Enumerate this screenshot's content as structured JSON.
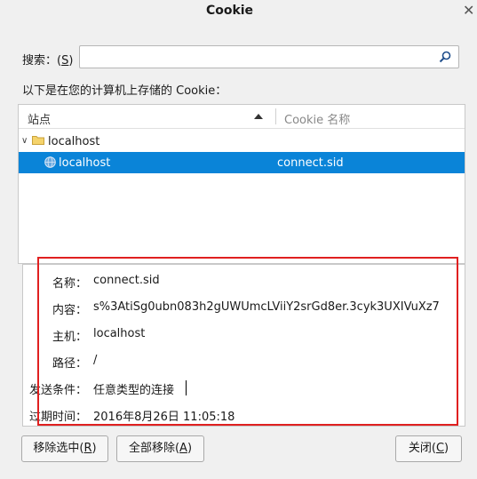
{
  "window": {
    "title": "Cookie",
    "close_glyph": "✕"
  },
  "search": {
    "label": "搜索：(",
    "key": "S",
    "label_end": ")",
    "value": "",
    "icon": "search-icon"
  },
  "caption": "以下是在您的计算机上存储的 Cookie：",
  "tree": {
    "columns": {
      "site": "站点",
      "cookie": "Cookie 名称"
    },
    "rows": [
      {
        "label": "localhost",
        "icon": "folder-icon",
        "expanded": true
      },
      {
        "label": "localhost",
        "value": "connect.sid",
        "icon": "globe-icon",
        "selected": true
      }
    ]
  },
  "details": {
    "fields": [
      {
        "label": "名称：",
        "value": "connect.sid"
      },
      {
        "label": "内容：",
        "value": "s%3AtiSg0ubn083h2gUWUmcLViiY2srGd8er.3cyk3UXIVuXz7"
      },
      {
        "label": "主机：",
        "value": "localhost"
      },
      {
        "label": "路径：",
        "value": "/"
      },
      {
        "label": "发送条件：",
        "value": "任意类型的连接"
      },
      {
        "label": "过期时间：",
        "value": "2016年8月26日 11:05:18"
      }
    ]
  },
  "buttons": {
    "remove_selected": {
      "label": "移除选中(",
      "key": "R",
      "end": ")"
    },
    "remove_all": {
      "label": "全部移除(",
      "key": "A",
      "end": ")"
    },
    "close": {
      "label": "关闭(",
      "key": "C",
      "end": ")"
    }
  },
  "colors": {
    "selection": "#0a84d8",
    "highlight_border": "#e02020",
    "background": "#f0f0f0"
  }
}
